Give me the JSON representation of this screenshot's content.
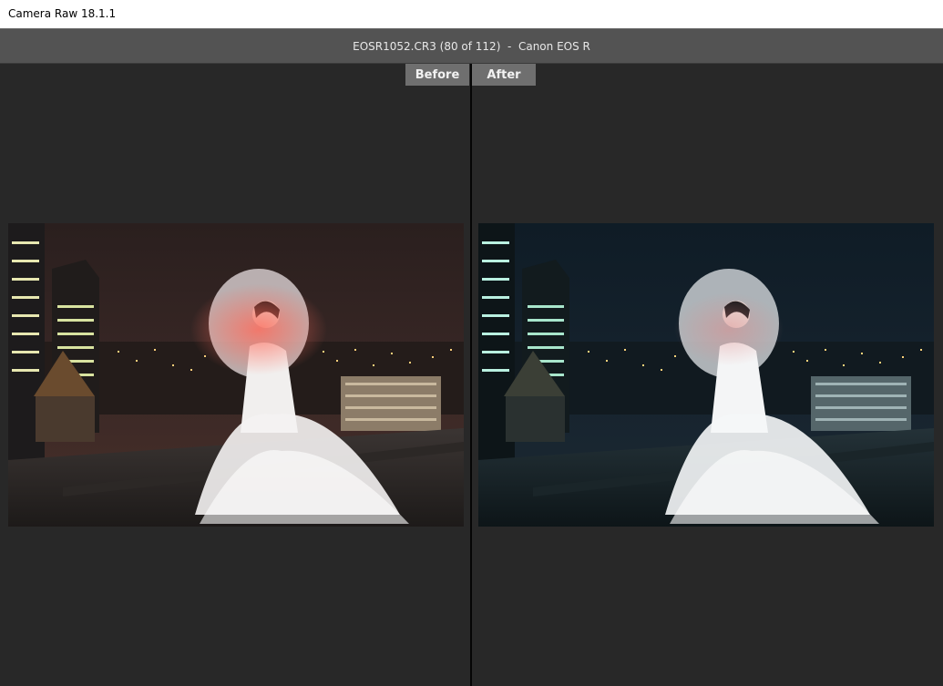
{
  "window": {
    "title": "Camera Raw 18.1.1"
  },
  "infobar": {
    "filename": "EOSR1052.CR3",
    "position": "(80 of 112)",
    "separator": "-",
    "camera": "Canon EOS R",
    "text": "EOSR1052.CR3 (80 of 112)  -  Canon EOS R"
  },
  "tabs": {
    "before_label": "Before",
    "after_label": "After"
  },
  "images": {
    "before": {
      "name": "photo-before",
      "tone": "warm"
    },
    "after": {
      "name": "photo-after",
      "tone": "cool"
    }
  },
  "colors": {
    "background": "#282828",
    "infobar": "#535353",
    "tab": "#6f6f6f",
    "divider": "#050505"
  }
}
